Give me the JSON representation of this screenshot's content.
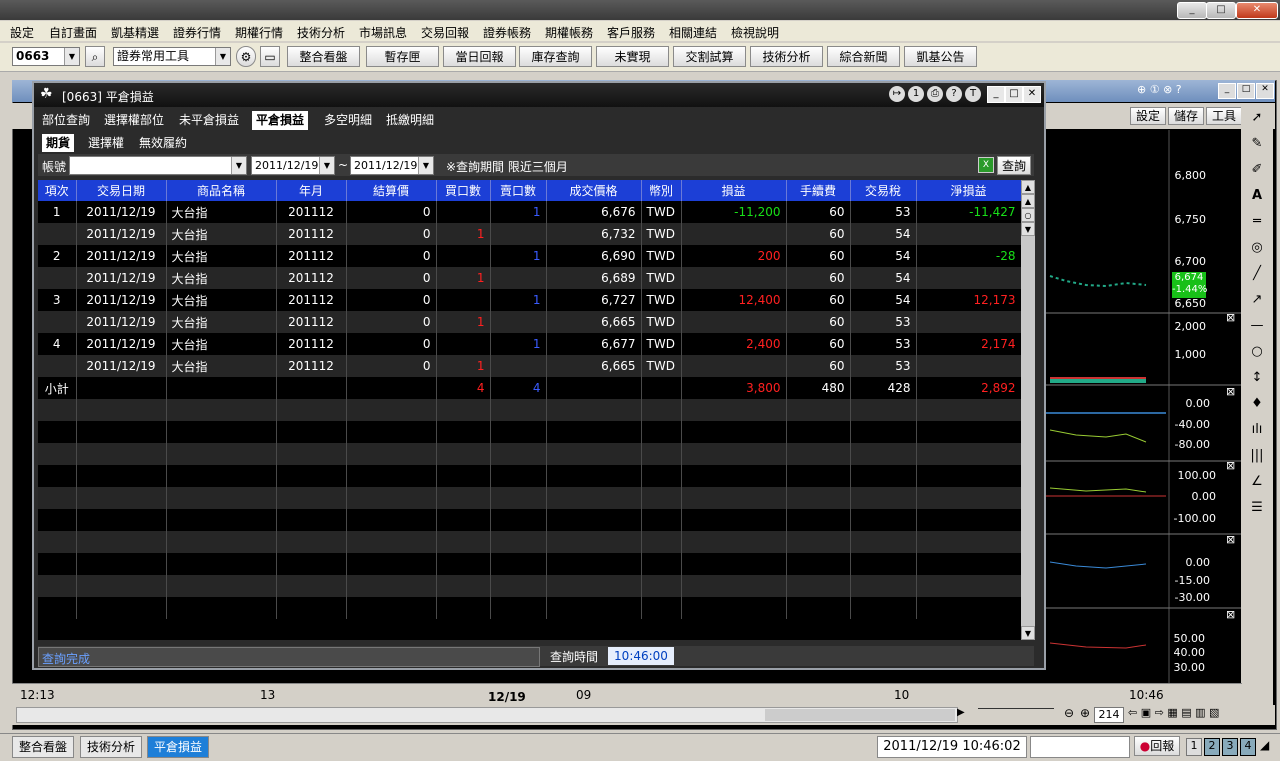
{
  "window": {
    "min": "_",
    "max": "□",
    "close": "✕"
  },
  "menu": [
    "設定",
    "自訂畫面",
    "凱基精選",
    "證券行情",
    "期權行情",
    "技術分析",
    "市場訊息",
    "交易回報",
    "證券帳務",
    "期權帳務",
    "客戶服務",
    "相關連結",
    "檢視說明"
  ],
  "toolbar": {
    "code": "0663",
    "tool_select": "證券常用工具",
    "buttons": [
      "整合看盤",
      "暫存匣",
      "當日回報",
      "庫存查詢",
      "未實現",
      "交割試算",
      "技術分析",
      "綜合新聞",
      "凱基公告"
    ]
  },
  "chart_window": {
    "buttons": [
      "設定",
      "儲存",
      "工具"
    ],
    "price_scale": [
      "6,800",
      "6,750",
      "6,700",
      "6,650"
    ],
    "current_price": "6,674",
    "current_change": "-1.44%",
    "vol_scale": [
      "2,000",
      "1,000"
    ],
    "ind1_scale": [
      "0.00",
      "-40.00",
      "-80.00"
    ],
    "ind2_scale": [
      "100.00",
      "0.00",
      "-100.00"
    ],
    "ind3_scale": [
      "0.00",
      "-15.00",
      "-30.00"
    ],
    "ind4_scale": [
      "50.00",
      "40.00",
      "30.00"
    ],
    "time_axis": [
      "12:13",
      "13",
      "12/19",
      "09",
      "10",
      "10:46"
    ],
    "bars_count": "214"
  },
  "dialog": {
    "title": "[0663] 平倉損益",
    "tabs": [
      "部位查詢",
      "選擇權部位",
      "未平倉損益",
      "平倉損益",
      "多空明細",
      "抵繳明細"
    ],
    "active_tab": "平倉損益",
    "subtabs": [
      "期貨",
      "選擇權",
      "無效履約"
    ],
    "filter": {
      "account_label": "帳號",
      "account_value": "",
      "date_from": "2011/12/19",
      "tilde": "~",
      "date_to": "2011/12/19",
      "note": "※查詢期間 限近三個月",
      "query_button": "查詢"
    },
    "columns": [
      "項次",
      "交易日期",
      "商品名稱",
      "年月",
      "結算價",
      "買口數",
      "賣口數",
      "成交價格",
      "幣別",
      "損益",
      "手續費",
      "交易稅",
      "淨損益"
    ],
    "rows": [
      {
        "idx": "1",
        "date": "2011/12/19",
        "name": "大台指",
        "ym": "201112",
        "settle": "0",
        "buy": "",
        "sell": "1",
        "price": "6,676",
        "cur": "TWD",
        "pl": "-11,200",
        "fee": "60",
        "tax": "53",
        "net": "-11,427",
        "plc": "grn",
        "netc": "grn"
      },
      {
        "idx": "",
        "date": "2011/12/19",
        "name": "大台指",
        "ym": "201112",
        "settle": "0",
        "buy": "1",
        "sell": "",
        "price": "6,732",
        "cur": "TWD",
        "pl": "",
        "fee": "60",
        "tax": "54",
        "net": "",
        "plc": "",
        "netc": ""
      },
      {
        "idx": "2",
        "date": "2011/12/19",
        "name": "大台指",
        "ym": "201112",
        "settle": "0",
        "buy": "",
        "sell": "1",
        "price": "6,690",
        "cur": "TWD",
        "pl": "200",
        "fee": "60",
        "tax": "54",
        "net": "-28",
        "plc": "red",
        "netc": "grn"
      },
      {
        "idx": "",
        "date": "2011/12/19",
        "name": "大台指",
        "ym": "201112",
        "settle": "0",
        "buy": "1",
        "sell": "",
        "price": "6,689",
        "cur": "TWD",
        "pl": "",
        "fee": "60",
        "tax": "54",
        "net": "",
        "plc": "",
        "netc": ""
      },
      {
        "idx": "3",
        "date": "2011/12/19",
        "name": "大台指",
        "ym": "201112",
        "settle": "0",
        "buy": "",
        "sell": "1",
        "price": "6,727",
        "cur": "TWD",
        "pl": "12,400",
        "fee": "60",
        "tax": "54",
        "net": "12,173",
        "plc": "red",
        "netc": "red"
      },
      {
        "idx": "",
        "date": "2011/12/19",
        "name": "大台指",
        "ym": "201112",
        "settle": "0",
        "buy": "1",
        "sell": "",
        "price": "6,665",
        "cur": "TWD",
        "pl": "",
        "fee": "60",
        "tax": "53",
        "net": "",
        "plc": "",
        "netc": ""
      },
      {
        "idx": "4",
        "date": "2011/12/19",
        "name": "大台指",
        "ym": "201112",
        "settle": "0",
        "buy": "",
        "sell": "1",
        "price": "6,677",
        "cur": "TWD",
        "pl": "2,400",
        "fee": "60",
        "tax": "53",
        "net": "2,174",
        "plc": "red",
        "netc": "red"
      },
      {
        "idx": "",
        "date": "2011/12/19",
        "name": "大台指",
        "ym": "201112",
        "settle": "0",
        "buy": "1",
        "sell": "",
        "price": "6,665",
        "cur": "TWD",
        "pl": "",
        "fee": "60",
        "tax": "53",
        "net": "",
        "plc": "",
        "netc": ""
      }
    ],
    "subtotal": {
      "label": "小計",
      "buy": "4",
      "sell": "4",
      "pl": "3,800",
      "fee": "480",
      "tax": "428",
      "net": "2,892"
    },
    "status": {
      "text": "查詢完成",
      "time_label": "查詢時間",
      "time": "10:46:00"
    }
  },
  "bottom": {
    "tabs": [
      "整合看盤",
      "技術分析",
      "平倉損益"
    ],
    "active_tab": "平倉損益",
    "datetime": "2011/12/19 10:46:02",
    "return_button": "回報",
    "nums": [
      "1",
      "2",
      "3",
      "4"
    ]
  },
  "colors": {
    "header_blue": "#1c3fd6",
    "profit_red": "#ff2020",
    "loss_green": "#18e018",
    "buy_red": "#ff2020",
    "sell_blue": "#3a5cff"
  }
}
